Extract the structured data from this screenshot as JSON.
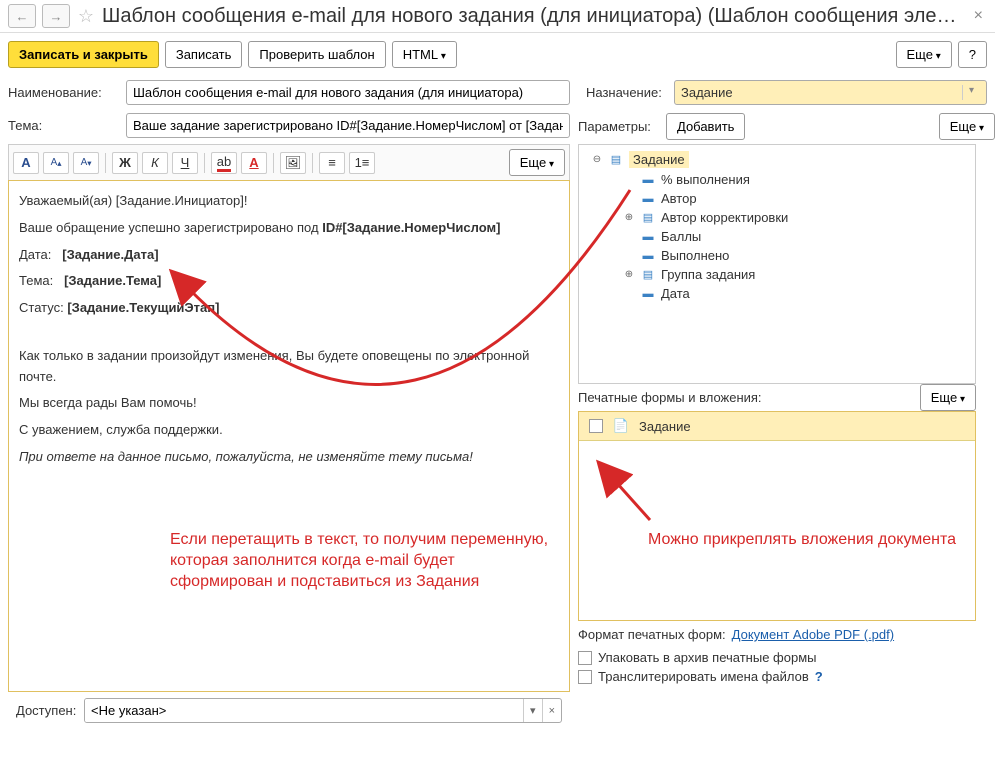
{
  "header": {
    "title": "Шаблон сообщения e-mail для нового задания (для инициатора) (Шаблон сообщения электр..."
  },
  "toolbar": {
    "save_close": "Записать и закрыть",
    "save": "Записать",
    "check": "Проверить шаблон",
    "html": "HTML",
    "more": "Еще",
    "help": "?"
  },
  "form": {
    "name_label": "Наименование:",
    "name_value": "Шаблон сообщения e-mail для нового задания (для инициатора)",
    "subject_label": "Тема:",
    "subject_value": "Ваше задание зарегистрировано ID#[Задание.НомерЧислом] от [Задание.",
    "purpose_label": "Назначение:",
    "purpose_value": "Задание",
    "params_label": "Параметры:",
    "params_add": "Добавить"
  },
  "editor": {
    "line1": "Уважаемый(ая) [Задание.Инициатор]!",
    "line2a": "Ваше обращение успешно зарегистрировано под ",
    "line2b": "ID#[Задание.НомерЧислом]",
    "date_lbl": "Дата:",
    "date_val": "[Задание.Дата]",
    "subj_lbl": "Тема:",
    "subj_val": "[Задание.Тема]",
    "status_lbl": "Статус:",
    "status_val": "[Задание.ТекущийЭтап]",
    "line6": "Как только в задании произойдут изменения, Вы будете оповещены по электронной почте.",
    "line7": "Мы всегда рады Вам помочь!",
    "line8": "С уважением, служба поддержки.",
    "line9": "При ответе на данное письмо, пожалуйста, не изменяйте тему письма!"
  },
  "tree": {
    "root": "Задание",
    "items": [
      "% выполнения",
      "Автор",
      "Автор корректировки",
      "Баллы",
      "Выполнено",
      "Группа задания",
      "Дата"
    ]
  },
  "attach": {
    "section_label": "Печатные формы и вложения:",
    "item": "Задание",
    "format_label": "Формат печатных форм:",
    "format_link": "Документ Adobe PDF (.pdf)",
    "pack": "Упаковать в архив печатные формы",
    "translit": "Транслитерировать имена файлов"
  },
  "bottom": {
    "available_label": "Доступен:",
    "available_value": "<Не указан>"
  },
  "annotations": {
    "left": "Если перетащить в текст, то получим переменную, которая заполнится когда e-mail будет сформирован и подставиться из Задания",
    "right": "Можно прикреплять вложения документа"
  },
  "more": "Еще"
}
